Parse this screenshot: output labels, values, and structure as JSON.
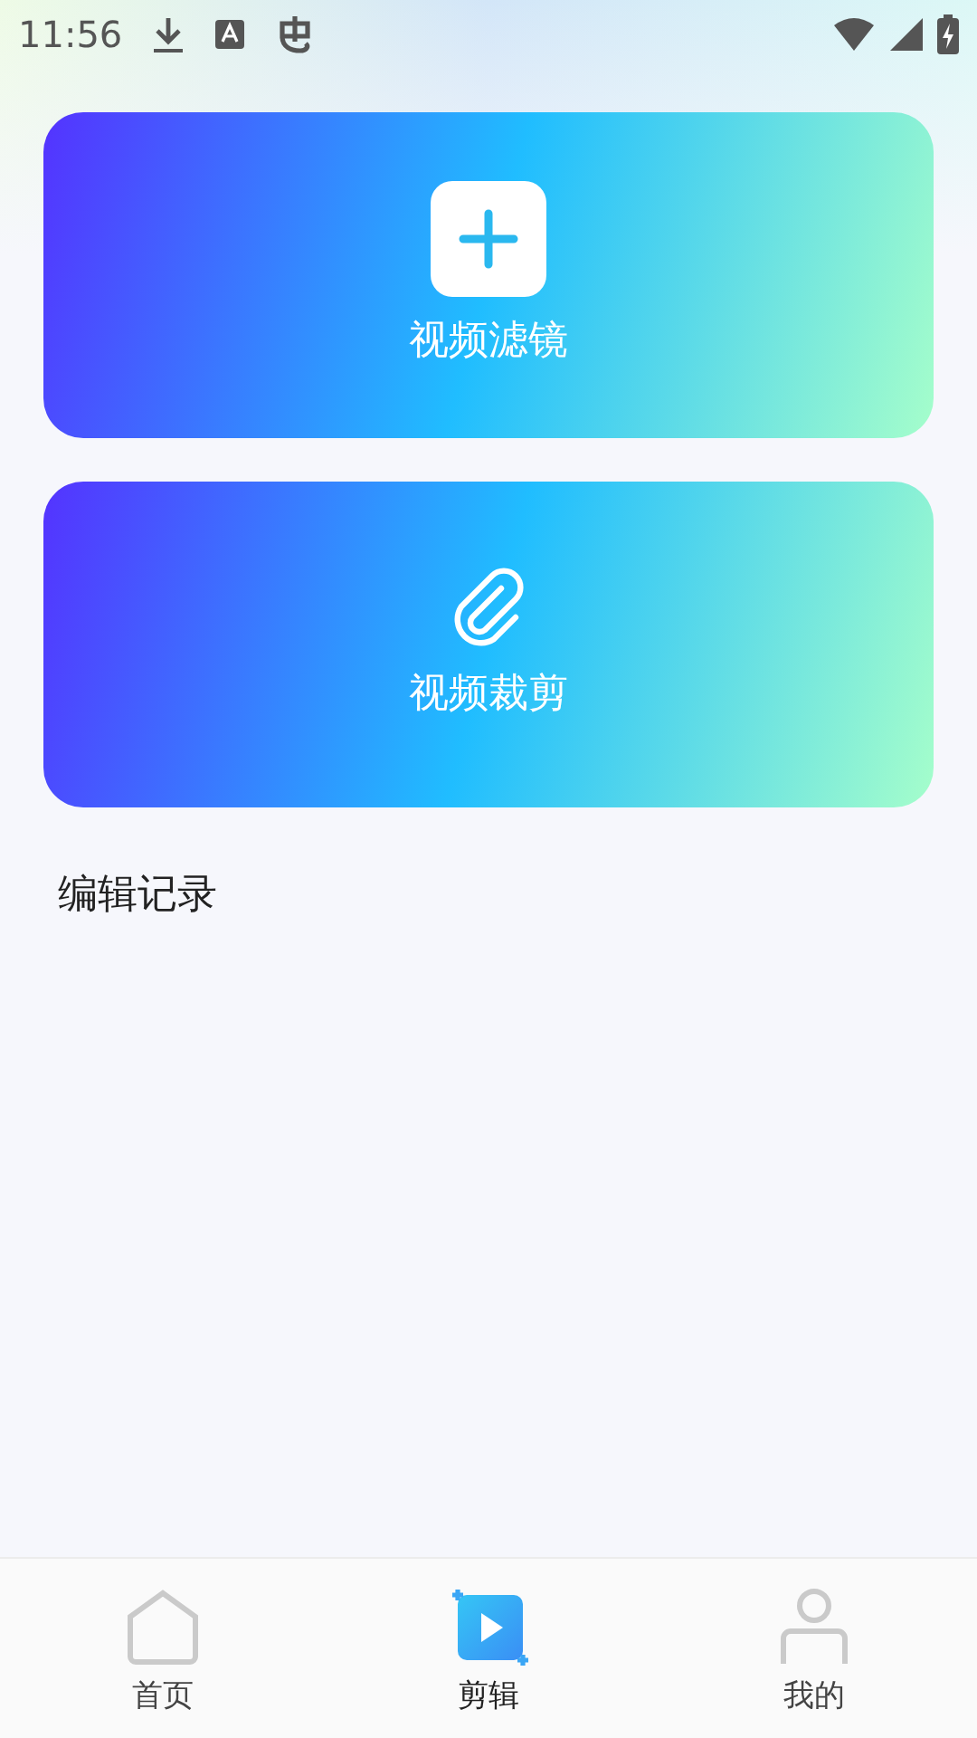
{
  "status_bar": {
    "time": "11:56"
  },
  "actions": [
    {
      "kind": "plus",
      "label": "视频滤镜"
    },
    {
      "kind": "clip",
      "label": "视频裁剪"
    }
  ],
  "section_title": "编辑记录",
  "tabs": [
    {
      "kind": "home",
      "label": "首页",
      "selected": false
    },
    {
      "kind": "edit",
      "label": "剪辑",
      "selected": true
    },
    {
      "kind": "user",
      "label": "我的",
      "selected": false
    }
  ]
}
